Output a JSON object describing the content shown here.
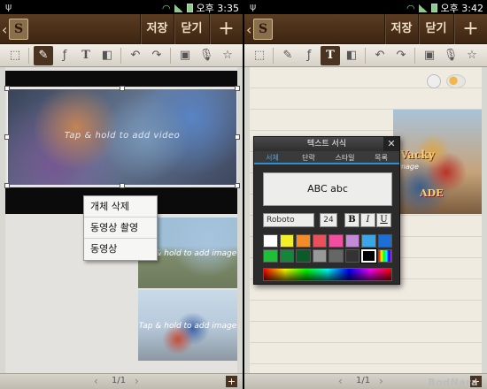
{
  "status": {
    "time_left": "오후 3:35",
    "time_right": "오후 3:42"
  },
  "titlebar": {
    "save": "저장",
    "close": "닫기",
    "add": "+"
  },
  "left": {
    "video_hint": "Tap & hold to add video",
    "image_hint_1": "Tap & hold to add image",
    "image_hint_2": "Tap & hold to add image",
    "context_menu": [
      "개체 삭제",
      "동영상 촬영",
      "동영상"
    ]
  },
  "right": {
    "image_banner": "Vacky",
    "image_sub": "ADE",
    "image_hint": "image"
  },
  "format_panel": {
    "title": "텍스트 서식",
    "tabs": [
      "서체",
      "단락",
      "스타일",
      "목록"
    ],
    "preview": "ABC abc",
    "font": "Roboto",
    "size": "24",
    "bold": "B",
    "italic": "I",
    "underline": "U",
    "colors": [
      "#ffffff",
      "#f2ee2a",
      "#f28b2a",
      "#e8505a",
      "#f04fa0",
      "#c48ad6",
      "#3aa6e8",
      "#1b6fd6",
      "#1fbf3a",
      "#14863a",
      "#0a5a2a",
      "#999999",
      "#666666",
      "#333333",
      "#000000",
      "rainbow"
    ],
    "selected_color": "#000000"
  },
  "pagebar": {
    "page": "1/1"
  },
  "watermark": "BodNara"
}
